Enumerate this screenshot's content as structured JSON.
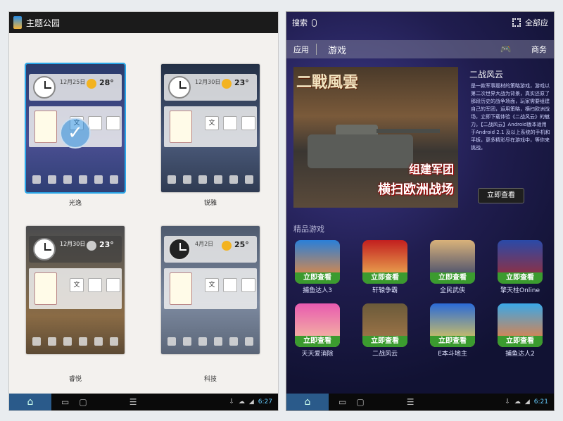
{
  "left": {
    "title": "主题公园",
    "themes": [
      {
        "label": "光逸",
        "date": "12月25日",
        "temp": "28°",
        "selected": true
      },
      {
        "label": "锐雅",
        "date": "12月30日",
        "temp": "23°",
        "selected": false
      },
      {
        "label": "睿悦",
        "date": "12月30日",
        "temp": "23°",
        "selected": false
      },
      {
        "label": "科技",
        "date": "4月2日",
        "temp": "25°",
        "selected": false
      }
    ],
    "mini_char": "文",
    "clock_time": "6:27"
  },
  "right": {
    "search_label": "搜索",
    "all_label": "全部应",
    "tabs": {
      "app": "应用",
      "game": "游戏",
      "biz": "商务"
    },
    "feature": {
      "banner_title": "二戰風雲",
      "slogan1": "组建军团",
      "slogan2": "横扫欧洲战场",
      "title": "二战风云",
      "desc": "是一款军事题材的策略游戏，游戏以第二次世界大战为背景，真实还原了那段历史的战争场面，玩家需要组建自己的军团，运用策略，横扫欧洲战场，立即下载体验《二战风云》的魅力。【二战风云】Android版本适用于Android 2.1 及以上系统的手机和平板，更多精彩尽在游戏中，等你来挑战。",
      "view_button": "立即查看"
    },
    "section_title": "精品游戏",
    "badge": "立即查看",
    "games": [
      {
        "name": "捕鱼达人3"
      },
      {
        "name": "轩辕争霸"
      },
      {
        "name": "全民武侠"
      },
      {
        "name": "擎天柱Online"
      },
      {
        "name": "天天爱消除"
      },
      {
        "name": "二战风云"
      },
      {
        "name": "E本斗地主"
      },
      {
        "name": "捕鱼达人2"
      }
    ],
    "clock_time": "6:21"
  }
}
